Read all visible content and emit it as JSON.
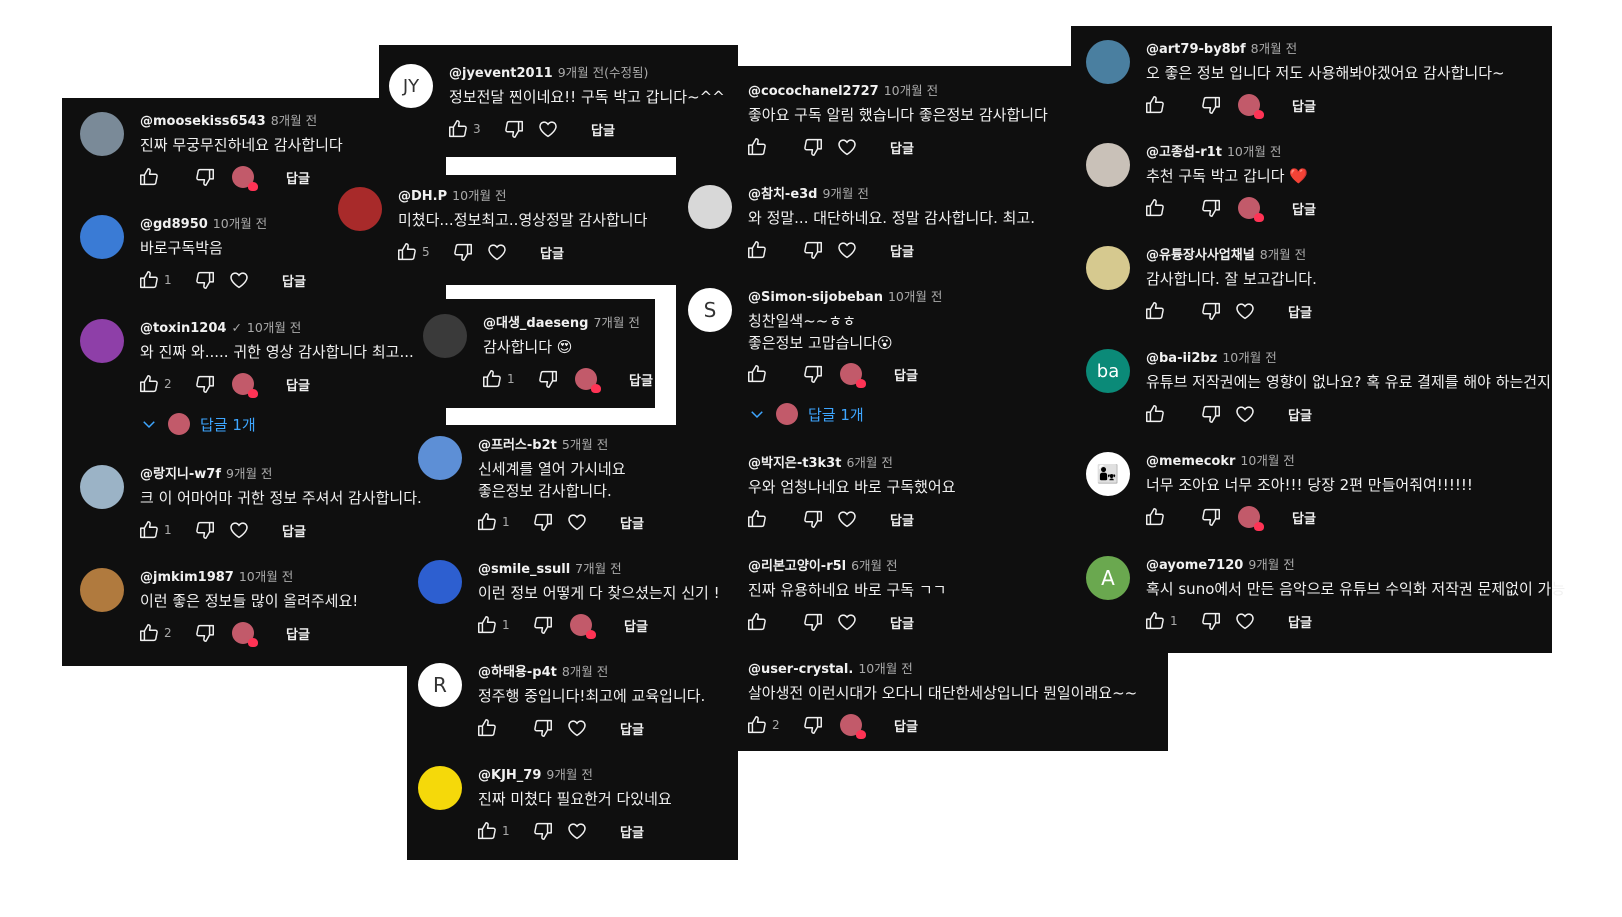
{
  "colors": {
    "bg": "#0f0f0f",
    "text": "#f1f1f1",
    "meta": "#aaaaaa",
    "link": "#3ea6ff"
  },
  "icons": {
    "like": "thumbs-up-icon",
    "dislike": "thumbs-down-icon",
    "heart": "heart-icon",
    "creator_heart": "creator-heart-avatar",
    "expand": "chevron-down-icon"
  },
  "reply_label": "답글",
  "col1": [
    {
      "name": "@moosekiss6543",
      "time": "8개월 전",
      "text": "진짜 무궁무진하네요 감사합니다",
      "likes": "",
      "hearted": true,
      "avatar": "#7a8a98"
    },
    {
      "name": "@gd8950",
      "time": "10개월 전",
      "text": "바로구독박음",
      "likes": "1",
      "hearted": false,
      "avatar": "#3a7bd5"
    },
    {
      "name": "@toxin1204",
      "time": "10개월 전",
      "verified": "✓",
      "text": "와 진짜 와..... 귀한 영상 감사합니다 최고...",
      "likes": "2",
      "hearted": true,
      "avatar": "#8e3fa8",
      "replies": "답글 1개"
    },
    {
      "name": "@랑지니-w7f",
      "time": "9개월 전",
      "text": "크 이 어마어마 귀한 정보 주셔서 감사합니다.",
      "likes": "1",
      "hearted": false,
      "avatar": "#9bb3c6"
    },
    {
      "name": "@jmkim1987",
      "time": "10개월 전",
      "text": "이런 좋은 정보들 많이 올려주세요!",
      "likes": "2",
      "hearted": true,
      "avatar": "#b07a3e"
    }
  ],
  "col2": [
    {
      "name": "@jyevent2011",
      "time": "9개월 전(수정됨)",
      "text": "정보전달 찐이네요!!  구독 박고 갑니다~^^",
      "likes": "3",
      "hearted": false,
      "avatar": "#ffffff",
      "avatar_text": "JY"
    },
    {
      "name": "@DH.P",
      "time": "10개월 전",
      "text": "미쳤다...정보최고..영상정말 감사합니다",
      "likes": "5",
      "hearted": false,
      "avatar": "#a82a2a"
    },
    {
      "name": "@대생_daeseng",
      "time": "7개월 전",
      "text": "감사합니다 😍",
      "likes": "1",
      "hearted": true,
      "avatar": "#3a3a3a"
    },
    {
      "name": "@프러스-b2t",
      "time": "5개월 전",
      "text": "신세계를 열어 가시네요",
      "text2": "좋은정보 감사합니다.",
      "likes": "1",
      "hearted": false,
      "avatar": "#5d8fd6"
    },
    {
      "name": "@smile_ssull",
      "time": "7개월 전",
      "text": "이런 정보 어떻게 다 찾으셨는지 신기 !",
      "likes": "1",
      "hearted": true,
      "avatar": "#2d5fd0"
    },
    {
      "name": "@하태용-p4t",
      "time": "8개월 전",
      "text": "정주행 중입니다!최고에 교육입니다.",
      "likes": "",
      "hearted": false,
      "avatar": "#ffffff",
      "avatar_text": "R"
    },
    {
      "name": "@KJH_79",
      "time": "9개월 전",
      "text": "진짜 미쳤다 필요한거 다있네요",
      "likes": "1",
      "hearted": false,
      "avatar": "#f5d90a"
    }
  ],
  "col3": [
    {
      "name": "@cocochanel2727",
      "time": "10개월 전",
      "text": "좋아요 구독 알림 했습니다 좋은정보 감사합니다",
      "likes": "",
      "hearted": false
    },
    {
      "name": "@참치-e3d",
      "time": "9개월 전",
      "text": "와 정말... 대단하네요. 정말 감사합니다. 최고.",
      "likes": "",
      "hearted": false,
      "avatar": "#d8d8d8"
    },
    {
      "name": "@Simon-sijobeban",
      "time": "10개월 전",
      "text": "칭찬일색~~ㅎㅎ",
      "text2": "좋은정보 고맙습니다😮",
      "likes": "",
      "hearted": true,
      "avatar": "#ffffff",
      "avatar_text": "S",
      "replies": "답글 1개"
    },
    {
      "name": "@박지은-t3k3t",
      "time": "6개월 전",
      "text": "우와 엄청나네요 바로 구독했어요",
      "likes": "",
      "hearted": false
    },
    {
      "name": "@리본고양이-r5l",
      "time": "6개월 전",
      "text": "진짜 유용하네요 바로 구독 ㄱㄱ",
      "likes": "",
      "hearted": false
    },
    {
      "name": "@user-crystal.",
      "time": "10개월 전",
      "text": "살아생전 이런시대가 오다니 대단한세상입니다  뭔일이래요~~",
      "likes": "2",
      "hearted": true
    }
  ],
  "col4": [
    {
      "name": "@art79-by8bf",
      "time": "8개월 전",
      "text": "오 좋은 정보 입니다 저도 사용해봐야겠어요 감사합니다~",
      "likes": "",
      "hearted": true,
      "avatar": "#4a7fa0"
    },
    {
      "name": "@고종섭-r1t",
      "time": "10개월 전",
      "text": "추천 구독 박고 갑니다 ❤️",
      "likes": "",
      "hearted": true,
      "avatar": "#c9c1b8"
    },
    {
      "name": "@유튱장사사업채널",
      "time": "8개월 전",
      "text": "감사합니다. 잘 보고갑니다.",
      "likes": "",
      "hearted": false,
      "avatar": "#d6c98f"
    },
    {
      "name": "@ba-ii2bz",
      "time": "10개월 전",
      "text": "유튜브 저작권에는 영향이 없나요? 혹 유료 결제를 해야 하는건지",
      "likes": "",
      "hearted": false,
      "avatar": "#0b8a78",
      "avatar_text": "ba"
    },
    {
      "name": "@memecokr",
      "time": "10개월 전",
      "text": "너무 조아요 너무 조아!!! 당장 2편 만들어줘여!!!!!!",
      "likes": "",
      "hearted": true,
      "avatar": "#ffffff",
      "avatar_text": "👨‍👧"
    },
    {
      "name": "@ayome7120",
      "time": "9개월 전",
      "text": "혹시 suno에서 만든 음악으로 유튜브 수익화 저작권 문제없이 가능",
      "likes": "1",
      "hearted": false,
      "avatar": "#6aa84f",
      "avatar_text": "A"
    }
  ]
}
